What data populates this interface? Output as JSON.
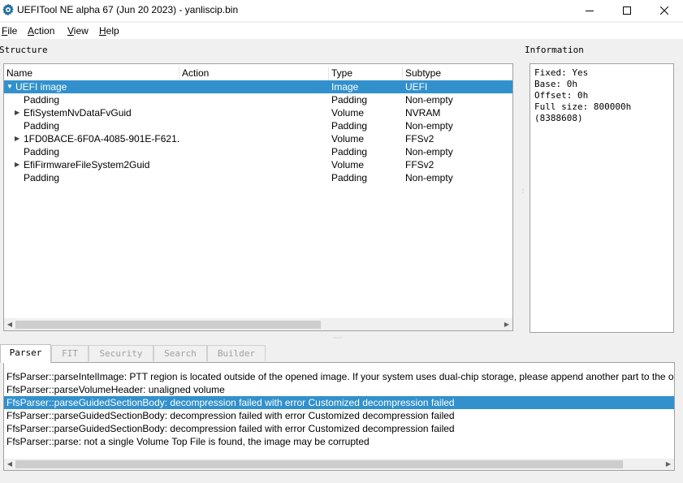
{
  "window": {
    "title": "UEFITool NE alpha 67 (Jun 20 2023) - yanliscip.bin",
    "icon": "gear-icon",
    "controls": [
      "minimize-icon",
      "maximize-icon",
      "close-icon"
    ]
  },
  "menu": {
    "items": [
      {
        "label": "File",
        "mnemonic": "F"
      },
      {
        "label": "Action",
        "mnemonic": "A"
      },
      {
        "label": "View",
        "mnemonic": "V"
      },
      {
        "label": "Help",
        "mnemonic": "H"
      }
    ]
  },
  "structure": {
    "label": "Structure",
    "columns": [
      "Name",
      "Action",
      "Type",
      "Subtype"
    ],
    "rows": [
      {
        "name": "UEFI image",
        "action": "",
        "type": "Image",
        "subtype": "UEFI",
        "expander": "expanded",
        "selected": true
      },
      {
        "name": "Padding",
        "action": "",
        "type": "Padding",
        "subtype": "Non-empty",
        "expander": "none"
      },
      {
        "name": "EfiSystemNvDataFvGuid",
        "action": "",
        "type": "Volume",
        "subtype": "NVRAM",
        "expander": "collapsed"
      },
      {
        "name": "Padding",
        "action": "",
        "type": "Padding",
        "subtype": "Non-empty",
        "expander": "none"
      },
      {
        "name": "1FD0BACE-6F0A-4085-901E-F621...",
        "action": "",
        "type": "Volume",
        "subtype": "FFSv2",
        "expander": "collapsed"
      },
      {
        "name": "Padding",
        "action": "",
        "type": "Padding",
        "subtype": "Non-empty",
        "expander": "none"
      },
      {
        "name": "EfiFirmwareFileSystem2Guid",
        "action": "",
        "type": "Volume",
        "subtype": "FFSv2",
        "expander": "collapsed"
      },
      {
        "name": "Padding",
        "action": "",
        "type": "Padding",
        "subtype": "Non-empty",
        "expander": "none"
      }
    ]
  },
  "information": {
    "label": "Information",
    "text": "Fixed: Yes\nBase: 0h\nOffset: 0h\nFull size: 800000h\n(8388608)"
  },
  "tabs": [
    {
      "label": "Parser",
      "active": true
    },
    {
      "label": "FIT",
      "active": false
    },
    {
      "label": "Security",
      "active": false
    },
    {
      "label": "Search",
      "active": false
    },
    {
      "label": "Builder",
      "active": false
    }
  ],
  "messages": [
    {
      "text": "FfsParser::parseIntelImage: PTT region is located outside of the opened image. If your system uses dual-chip storage, please append another part to the open",
      "selected": false
    },
    {
      "text": "FfsParser::parseVolumeHeader: unaligned volume",
      "selected": false
    },
    {
      "text": "FfsParser::parseGuidedSectionBody: decompression failed with error Customized decompression failed",
      "selected": true
    },
    {
      "text": "FfsParser::parseGuidedSectionBody: decompression failed with error Customized decompression failed",
      "selected": false
    },
    {
      "text": "FfsParser::parseGuidedSectionBody: decompression failed with error Customized decompression failed",
      "selected": false
    },
    {
      "text": "FfsParser::parse: not a single Volume Top File is found, the image may be corrupted",
      "selected": false
    }
  ],
  "colors": {
    "selection": "#3291cc",
    "panel_bg": "#ffffff",
    "window_bg": "#f0f0f0",
    "icon_blue": "#1f6e9e"
  }
}
